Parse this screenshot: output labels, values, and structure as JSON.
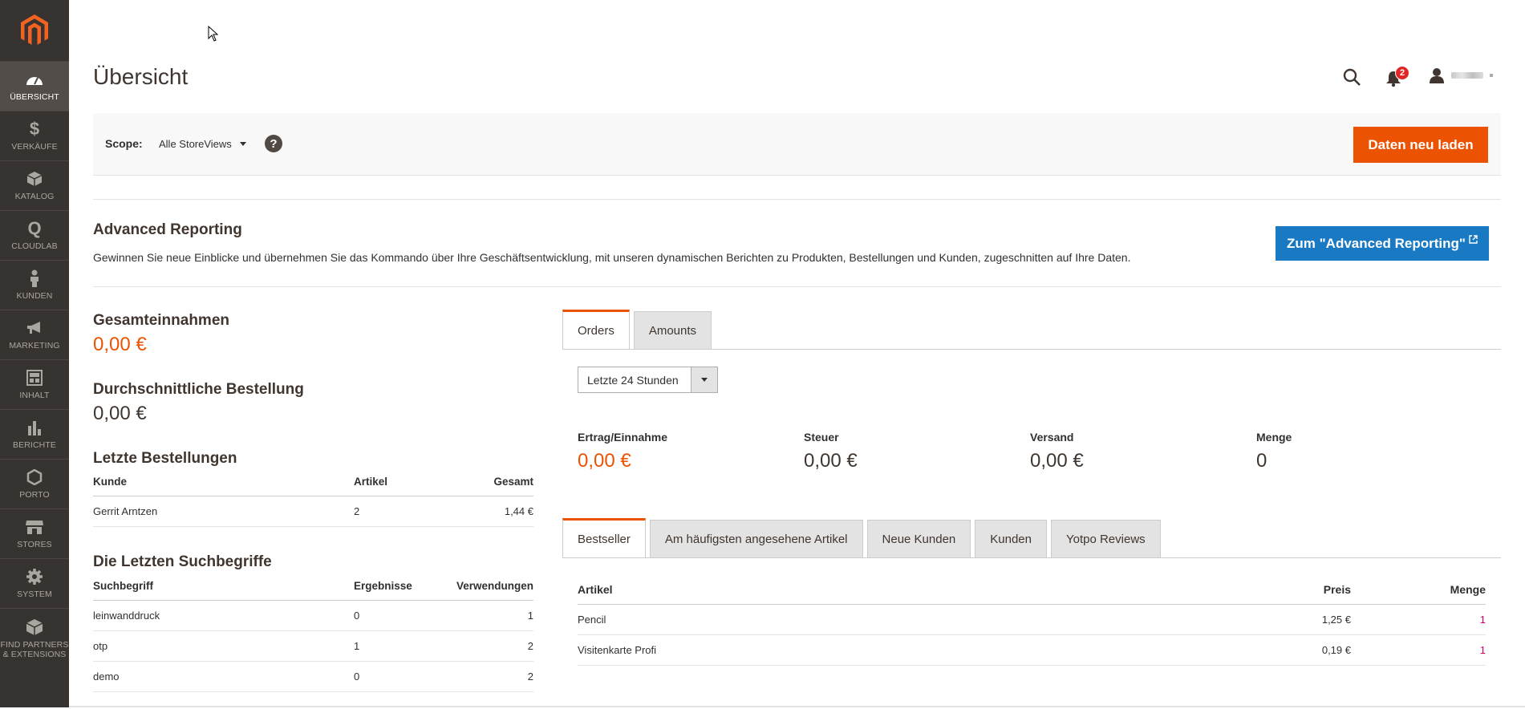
{
  "sidebar": {
    "items": [
      {
        "label": "ÜBERSICHT",
        "icon": "dashboard-icon",
        "active": true
      },
      {
        "label": "VERKÄUFE",
        "icon": "dollar-icon"
      },
      {
        "label": "KATALOG",
        "icon": "box-icon"
      },
      {
        "label": "CLOUDLAB",
        "icon": "cloudlab-icon"
      },
      {
        "label": "KUNDEN",
        "icon": "person-icon"
      },
      {
        "label": "MARKETING",
        "icon": "megaphone-icon"
      },
      {
        "label": "INHALT",
        "icon": "content-icon"
      },
      {
        "label": "BERICHTE",
        "icon": "bar-chart-icon"
      },
      {
        "label": "PORTO",
        "icon": "hexagon-icon"
      },
      {
        "label": "STORES",
        "icon": "store-icon"
      },
      {
        "label": "SYSTEM",
        "icon": "gear-icon"
      },
      {
        "label": "FIND PARTNERS & EXTENSIONS",
        "icon": "extensions-icon"
      }
    ]
  },
  "header": {
    "title": "Übersicht",
    "notifications_count": "2"
  },
  "scope": {
    "label": "Scope:",
    "value": "Alle StoreViews",
    "help": "?",
    "reload_label": "Daten neu laden"
  },
  "advanced_reporting": {
    "title": "Advanced Reporting",
    "description": "Gewinnen Sie neue Einblicke und übernehmen Sie das Kommando über Ihre Geschäftsentwicklung, mit unseren dynamischen Berichten zu Produkten, Bestellungen und Kunden, zugeschnitten auf Ihre Daten.",
    "button_label": "Zum \"Advanced Reporting\""
  },
  "stats": {
    "total_label": "Gesamteinnahmen",
    "total_value": "0,00 €",
    "avg_label": "Durchschnittliche Bestellung",
    "avg_value": "0,00 €"
  },
  "recent_orders": {
    "title": "Letzte Bestellungen",
    "headers": [
      "Kunde",
      "Artikel",
      "Gesamt"
    ],
    "rows": [
      {
        "customer": "Gerrit Arntzen",
        "items": "2",
        "total": "1,44 €"
      }
    ]
  },
  "recent_searches": {
    "title": "Die Letzten Suchbegriffe",
    "headers": [
      "Suchbegriff",
      "Ergebnisse",
      "Verwendungen"
    ],
    "rows": [
      {
        "term": "leinwanddruck",
        "results": "0",
        "uses": "1"
      },
      {
        "term": "otp",
        "results": "1",
        "uses": "2"
      },
      {
        "term": "demo",
        "results": "0",
        "uses": "2"
      }
    ]
  },
  "chart_tabs": {
    "tabs": [
      "Orders",
      "Amounts"
    ],
    "period": "Letzte 24 Stunden"
  },
  "metrics": [
    {
      "label": "Ertrag/Einnahme",
      "value": "0,00 €"
    },
    {
      "label": "Steuer",
      "value": "0,00 €"
    },
    {
      "label": "Versand",
      "value": "0,00 €"
    },
    {
      "label": "Menge",
      "value": "0"
    }
  ],
  "grid_tabs": {
    "tabs": [
      "Bestseller",
      "Am häufigsten angesehene Artikel",
      "Neue Kunden",
      "Kunden",
      "Yotpo Reviews"
    ]
  },
  "bestsellers": {
    "headers": [
      "Artikel",
      "Preis",
      "Menge"
    ],
    "rows": [
      {
        "product": "Pencil",
        "price": "1,25 €",
        "qty": "1"
      },
      {
        "product": "Visitenkarte Profi",
        "price": "0,19 €",
        "qty": "1"
      }
    ]
  },
  "colors": {
    "sidebar_bg": "#373330",
    "accent_orange": "#eb5202",
    "primary_blue": "#1979c3"
  }
}
